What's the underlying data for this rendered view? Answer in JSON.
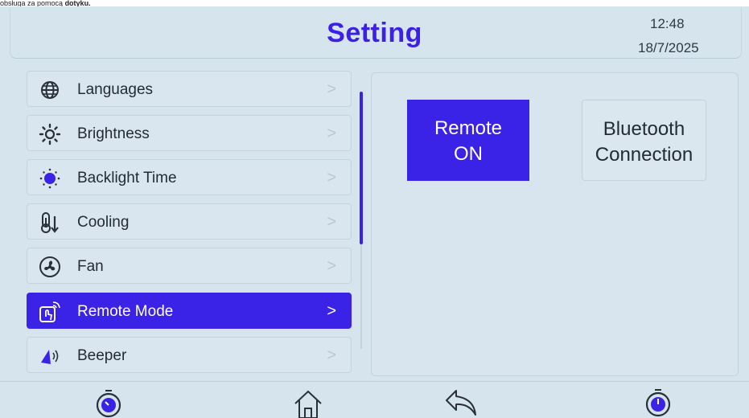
{
  "caption": {
    "text": "obsługa za pomocą ",
    "bold": "dotyku."
  },
  "header": {
    "title": "Setting",
    "time": "12:48",
    "date": "18/7/2025"
  },
  "menu": {
    "items": [
      {
        "label": "Languages",
        "icon": "globe-icon"
      },
      {
        "label": "Brightness",
        "icon": "sun-icon"
      },
      {
        "label": "Backlight Time",
        "icon": "backlight-icon"
      },
      {
        "label": "Cooling",
        "icon": "thermometer-icon"
      },
      {
        "label": "Fan",
        "icon": "fan-icon"
      },
      {
        "label": "Remote Mode",
        "icon": "remote-touch-icon",
        "active": true
      },
      {
        "label": "Beeper",
        "icon": "speaker-icon"
      }
    ],
    "chevron": ">"
  },
  "panel": {
    "remote_line1": "Remote",
    "remote_line2": "ON",
    "bt_line1": "Bluetooth",
    "bt_line2": "Connection"
  },
  "footer": {
    "icons": [
      "dial-icon",
      "home-icon",
      "back-icon",
      "timer-icon"
    ]
  },
  "colors": {
    "accent": "#3a22e6",
    "screen_bg": "#d6e4ee",
    "title": "#3d20e8"
  }
}
